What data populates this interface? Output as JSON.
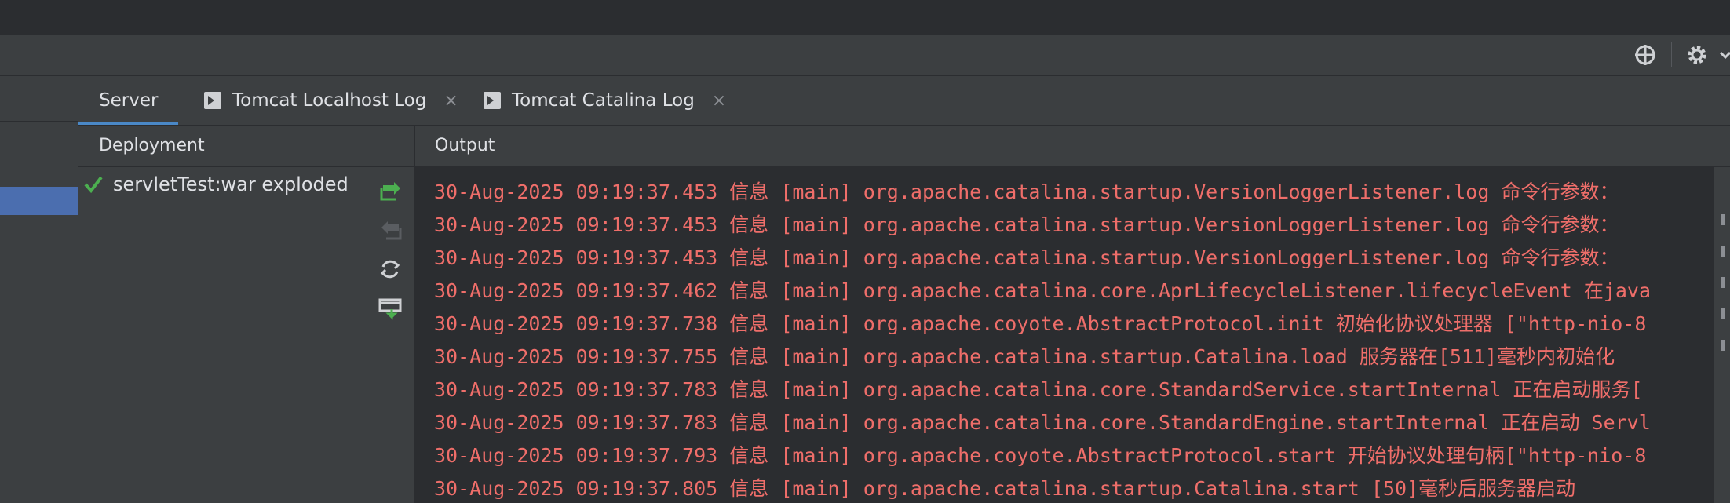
{
  "tabs": [
    {
      "label": "Server",
      "active": true
    },
    {
      "label": "Tomcat Localhost Log",
      "icon": "terminal-icon",
      "close": "×"
    },
    {
      "label": "Tomcat Catalina Log",
      "icon": "terminal-icon",
      "close": "×"
    }
  ],
  "deployment": {
    "header": "Deployment",
    "item_label": "servletTest:war exploded",
    "item_icon": "green-check-icon"
  },
  "output": {
    "header": "Output",
    "lines": [
      "30-Aug-2025 09:19:37.453 信息 [main] org.apache.catalina.startup.VersionLoggerListener.log 命令行参数：",
      "30-Aug-2025 09:19:37.453 信息 [main] org.apache.catalina.startup.VersionLoggerListener.log 命令行参数：",
      "30-Aug-2025 09:19:37.453 信息 [main] org.apache.catalina.startup.VersionLoggerListener.log 命令行参数：",
      "30-Aug-2025 09:19:37.462 信息 [main] org.apache.catalina.core.AprLifecycleListener.lifecycleEvent 在java",
      "30-Aug-2025 09:19:37.738 信息 [main] org.apache.coyote.AbstractProtocol.init 初始化协议处理器 [\"http-nio-8",
      "30-Aug-2025 09:19:37.755 信息 [main] org.apache.catalina.startup.Catalina.load 服务器在[511]毫秒内初始化",
      "30-Aug-2025 09:19:37.783 信息 [main] org.apache.catalina.core.StandardService.startInternal 正在启动服务[",
      "30-Aug-2025 09:19:37.783 信息 [main] org.apache.catalina.core.StandardEngine.startInternal 正在启动 Servl",
      "30-Aug-2025 09:19:37.793 信息 [main] org.apache.coyote.AbstractProtocol.start 开始协议处理句柄[\"http-nio-8",
      "30-Aug-2025 09:19:37.805 信息 [main] org.apache.catalina.startup.Catalina.start [50]毫秒后服务器启动"
    ],
    "text_color": "#ef6e6a"
  },
  "colors": {
    "background": "#2b2d30",
    "panel": "#3c3f41",
    "accent": "#4a88c7",
    "selection": "#4b6eaf",
    "green": "#4caf50"
  }
}
